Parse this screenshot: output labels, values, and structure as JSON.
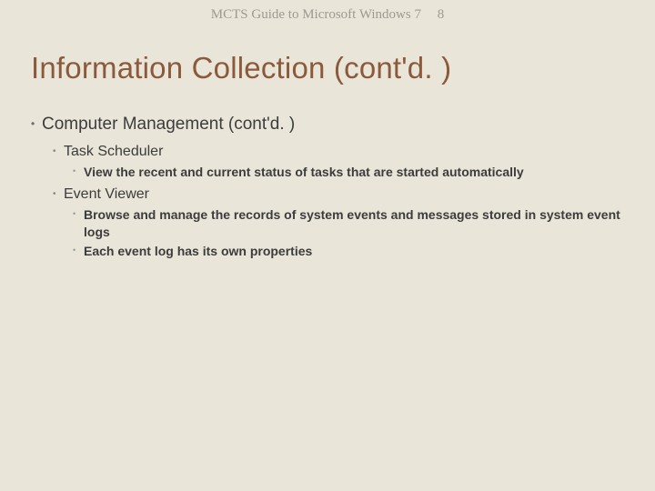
{
  "header": {
    "book": "MCTS Guide to Microsoft Windows 7",
    "page": "8"
  },
  "title": "Information Collection (cont'd. )",
  "bullets": {
    "lvl1": "Computer Management (cont'd. )",
    "lvl2a": "Task Scheduler",
    "lvl3a": "View the recent and current status of tasks that are started automatically",
    "lvl2b": "Event Viewer",
    "lvl3b": "Browse and manage the records of system events and messages stored in system event logs",
    "lvl3c": "Each event log has its own properties"
  }
}
